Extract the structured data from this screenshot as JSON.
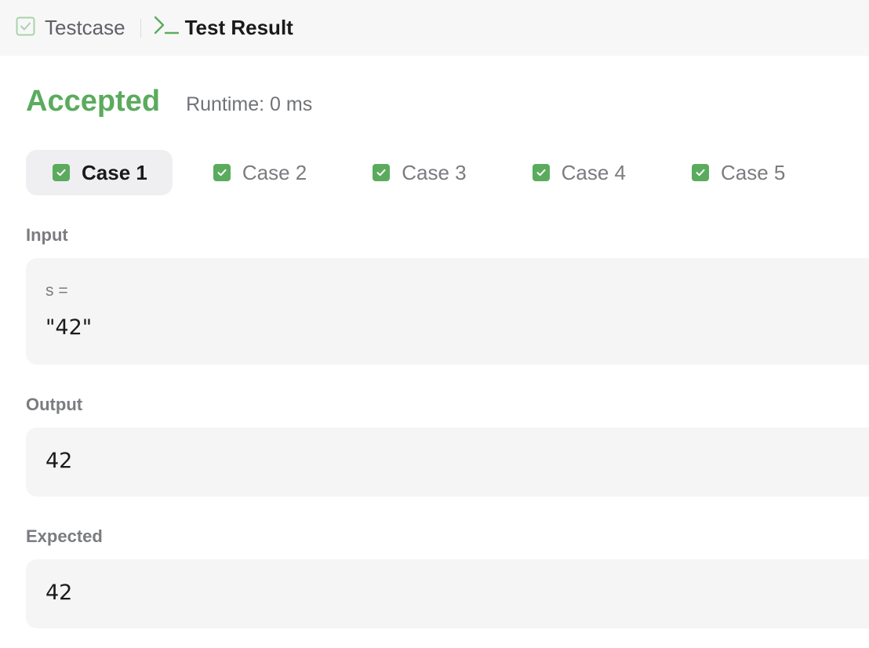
{
  "tabs": {
    "testcase_label": "Testcase",
    "result_label": "Test Result"
  },
  "result": {
    "status": "Accepted",
    "runtime": "Runtime: 0 ms",
    "status_color": "#5bab5e"
  },
  "cases": [
    {
      "label": "Case 1",
      "active": true,
      "passed": true
    },
    {
      "label": "Case 2",
      "active": false,
      "passed": true
    },
    {
      "label": "Case 3",
      "active": false,
      "passed": true
    },
    {
      "label": "Case 4",
      "active": false,
      "passed": true
    },
    {
      "label": "Case 5",
      "active": false,
      "passed": true
    }
  ],
  "input": {
    "label": "Input",
    "var_name": "s =",
    "var_value": "\"42\""
  },
  "output": {
    "label": "Output",
    "value": "42"
  },
  "expected": {
    "label": "Expected",
    "value": "42"
  }
}
